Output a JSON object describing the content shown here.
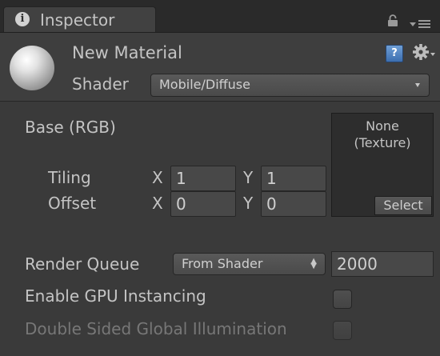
{
  "tab": {
    "title": "Inspector",
    "icon": "info-icon"
  },
  "tab_actions": {
    "lock_icon": "lock-icon",
    "menu_icon": "tab-menu-icon"
  },
  "header": {
    "material_name": "New Material",
    "shader_label": "Shader",
    "shader_value": "Mobile/Diffuse",
    "help_icon": "help-icon",
    "help_glyph": "?",
    "settings_icon": "gear-icon"
  },
  "texture": {
    "label": "Base (RGB)",
    "slot_line1": "None",
    "slot_line2": "(Texture)",
    "select_label": "Select",
    "tiling_label": "Tiling",
    "offset_label": "Offset",
    "x_label": "X",
    "y_label": "Y",
    "tiling_x": "1",
    "tiling_y": "1",
    "offset_x": "0",
    "offset_y": "0"
  },
  "render_queue": {
    "label": "Render Queue",
    "mode": "From Shader",
    "value": "2000"
  },
  "gpu_instancing": {
    "label": "Enable GPU Instancing",
    "checked": false
  },
  "double_sided_gi": {
    "label": "Double Sided Global Illumination",
    "checked": false,
    "enabled": false
  },
  "colors": {
    "panel_bg": "#3a3a3a",
    "tabbar_bg": "#2a2a2a",
    "text": "#c4c4c4",
    "disabled_text": "#777777",
    "field_bg": "#484848",
    "help_blue": "#3c6eaf"
  }
}
